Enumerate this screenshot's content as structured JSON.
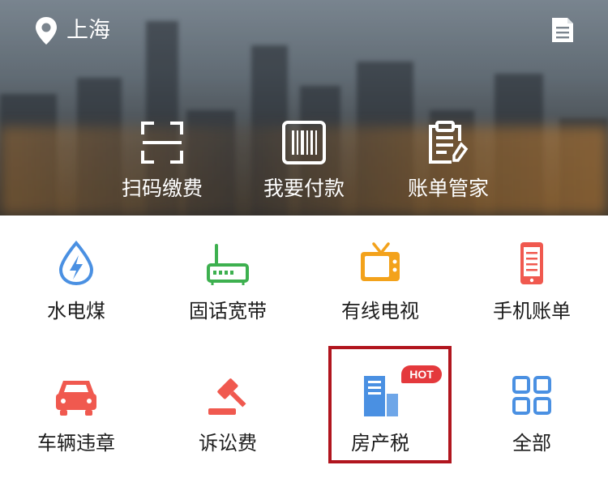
{
  "location": {
    "city": "上海",
    "icon": "location-pin-icon"
  },
  "header": {
    "doc_icon": "document-icon"
  },
  "quick_actions": [
    {
      "label": "扫码缴费",
      "icon": "scan-frame-icon"
    },
    {
      "label": "我要付款",
      "icon": "barcode-icon"
    },
    {
      "label": "账单管家",
      "icon": "clipboard-pen-icon"
    }
  ],
  "services": [
    {
      "label": "水电煤",
      "icon": "water-drop-bolt-icon",
      "color": "#4a90e2"
    },
    {
      "label": "固话宽带",
      "icon": "router-icon",
      "color": "#3db04f"
    },
    {
      "label": "有线电视",
      "icon": "tv-icon",
      "color": "#f3a21b"
    },
    {
      "label": "手机账单",
      "icon": "mobile-phone-icon",
      "color": "#f0594f"
    },
    {
      "label": "车辆违章",
      "icon": "car-icon",
      "color": "#f0594f"
    },
    {
      "label": "诉讼费",
      "icon": "gavel-icon",
      "color": "#f0594f"
    },
    {
      "label": "房产税",
      "icon": "buildings-icon",
      "color": "#4a90e2",
      "badge": "HOT"
    },
    {
      "label": "全部",
      "icon": "grid-icon",
      "color": "#4a90e2"
    }
  ]
}
